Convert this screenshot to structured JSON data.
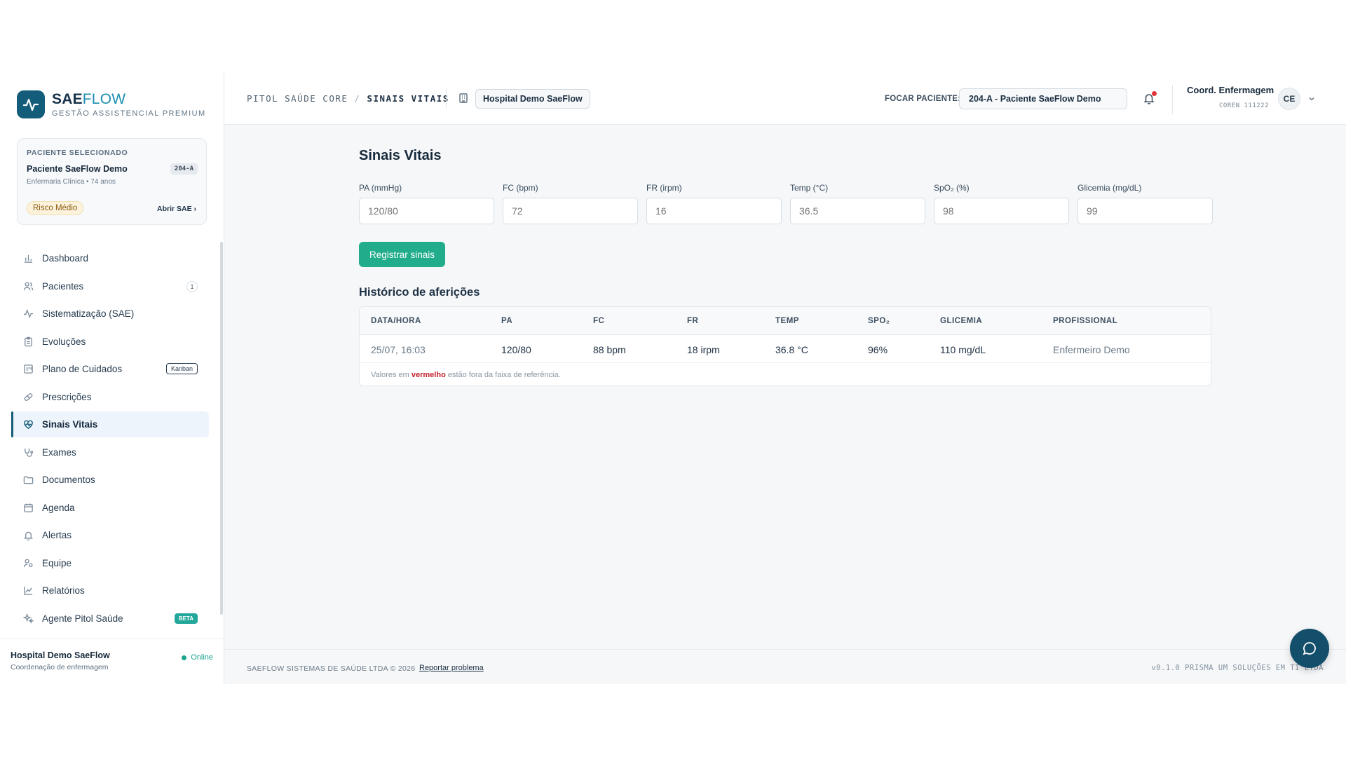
{
  "brand": {
    "name_a": "SAE",
    "name_b": "FLOW",
    "subtitle": "GESTÃO ASSISTENCIAL PREMIUM"
  },
  "patient_card": {
    "label": "PACIENTE SELECIONADO",
    "name": "Paciente SaeFlow Demo",
    "bed": "204-A",
    "meta": "Enfermaria Clínica • 74 anos",
    "risk": "Risco Médio",
    "open_link": "Abrir SAE"
  },
  "nav": [
    {
      "label": "Dashboard",
      "icon": "bar-chart-icon"
    },
    {
      "label": "Pacientes",
      "icon": "users-icon",
      "badge": "1"
    },
    {
      "label": "Sistematização (SAE)",
      "icon": "activity-icon"
    },
    {
      "label": "Evoluções",
      "icon": "clipboard-icon"
    },
    {
      "label": "Plano de Cuidados",
      "icon": "kanban-board-icon",
      "tag": "Kanban"
    },
    {
      "label": "Prescrições",
      "icon": "pill-icon"
    },
    {
      "label": "Sinais Vitais",
      "icon": "heart-pulse-icon",
      "active": true
    },
    {
      "label": "Exames",
      "icon": "stethoscope-icon"
    },
    {
      "label": "Documentos",
      "icon": "folder-icon"
    },
    {
      "label": "Agenda",
      "icon": "calendar-icon"
    },
    {
      "label": "Alertas",
      "icon": "bell-icon"
    },
    {
      "label": "Equipe",
      "icon": "user-team-icon"
    },
    {
      "label": "Relatórios",
      "icon": "line-chart-icon"
    },
    {
      "label": "Agente Pitol Saúde",
      "icon": "sparkles-icon",
      "beta": "BETA"
    }
  ],
  "sidebar_footer": {
    "hospital": "Hospital Demo SaeFlow",
    "role": "Coordenação de enfermagem",
    "status": "Online"
  },
  "header": {
    "crumb_root": "PITOL SAÚDE CORE",
    "crumb_sep": "/",
    "crumb_current": "SINAIS VITAIS",
    "hospital": "Hospital Demo SaeFlow",
    "focus_label": "FOCAR PACIENTE:",
    "focus_value": "204-A - Paciente SaeFlow Demo",
    "user_name": "Coord. Enfermagem",
    "user_coren": "COREN 111222",
    "user_initials": "CE"
  },
  "main": {
    "title": "Sinais Vitais",
    "fields": [
      {
        "label": "PA (mmHg)",
        "placeholder": "120/80"
      },
      {
        "label": "FC (bpm)",
        "placeholder": "72"
      },
      {
        "label": "FR (irpm)",
        "placeholder": "16"
      },
      {
        "label": "Temp (°C)",
        "placeholder": "36.5"
      },
      {
        "label": "SpO₂ (%)",
        "placeholder": "98"
      },
      {
        "label": "Glicemia (mg/dL)",
        "placeholder": "99"
      }
    ],
    "register_button": "Registrar sinais",
    "history_title": "Histórico de aferições",
    "columns": [
      "DATA/HORA",
      "PA",
      "FC",
      "FR",
      "TEMP",
      "SPO₂",
      "GLICEMIA",
      "PROFISSIONAL"
    ],
    "rows": [
      [
        "25/07, 16:03",
        "120/80",
        "88 bpm",
        "18 irpm",
        "36.8 °C",
        "96%",
        "110 mg/dL",
        "Enfermeiro Demo"
      ]
    ],
    "note_a": "Valores em ",
    "note_red": "vermelho",
    "note_b": " estão fora da faixa de referência."
  },
  "footer": {
    "copyright": "SAEFLOW SISTEMAS DE SAÚDE LTDA © 2026",
    "report_link": "Reportar problema",
    "version": "v0.1.0   PRISMA UM SOLUÇÕES EM TI LTDA"
  },
  "colors": {
    "primary": "#135c7a",
    "accent": "#21ac8b",
    "alert": "#e0343c"
  }
}
